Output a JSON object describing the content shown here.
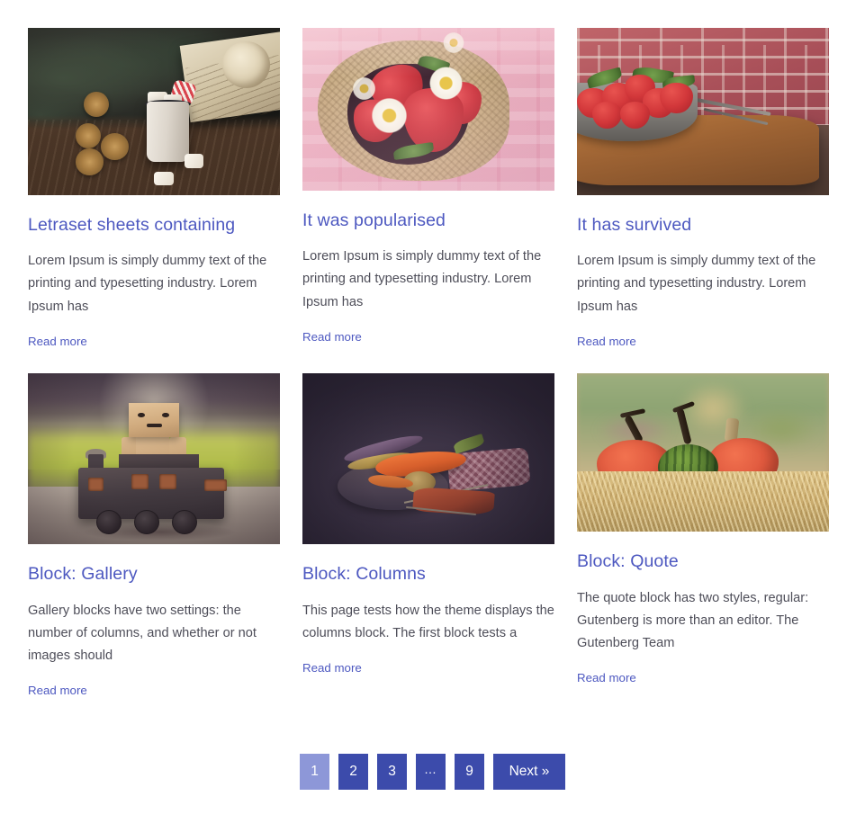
{
  "posts": [
    {
      "title": "Letraset sheets containing",
      "excerpt": "Lorem Ipsum is simply dummy text of the printing and typesetting industry. Lorem Ipsum has",
      "read_more": "Read more",
      "image_alt": "hot-cocoa-mug-winter-photo"
    },
    {
      "title": "It was popularised",
      "excerpt": "Lorem Ipsum is simply dummy text of the printing and typesetting industry. Lorem Ipsum has",
      "read_more": "Read more",
      "image_alt": "strawberries-in-bowl-pink-photo"
    },
    {
      "title": "It has survived",
      "excerpt": "Lorem Ipsum is simply dummy text of the printing and typesetting industry. Lorem Ipsum has",
      "read_more": "Read more",
      "image_alt": "strawberries-brick-wall-photo"
    },
    {
      "title": "Block: Gallery",
      "excerpt": "Gallery blocks have two settings: the number of columns, and whether or not images should",
      "read_more": "Read more",
      "image_alt": "cardboard-robot-toy-train-photo"
    },
    {
      "title": "Block: Columns",
      "excerpt": "This page tests how the theme displays the columns block. The first block tests a",
      "read_more": "Read more",
      "image_alt": "carrots-dark-still-life-photo"
    },
    {
      "title": "Block: Quote",
      "excerpt": "The quote block has two styles, regular: Gutenberg is more than an editor. The Gutenberg Team",
      "read_more": "Read more",
      "image_alt": "pumpkins-on-straw-photo"
    }
  ],
  "pagination": {
    "items": [
      {
        "label": "1",
        "current": true
      },
      {
        "label": "2",
        "current": false
      },
      {
        "label": "3",
        "current": false
      },
      {
        "label": "…",
        "current": false
      },
      {
        "label": "9",
        "current": false
      },
      {
        "label": "Next »",
        "current": false
      }
    ]
  },
  "colors": {
    "link": "#4d58c0",
    "body_text": "#4e4e59",
    "pagination_bg": "#3c4bab",
    "pagination_current_bg": "#8d97d8",
    "page_bg": "#ffffff"
  }
}
